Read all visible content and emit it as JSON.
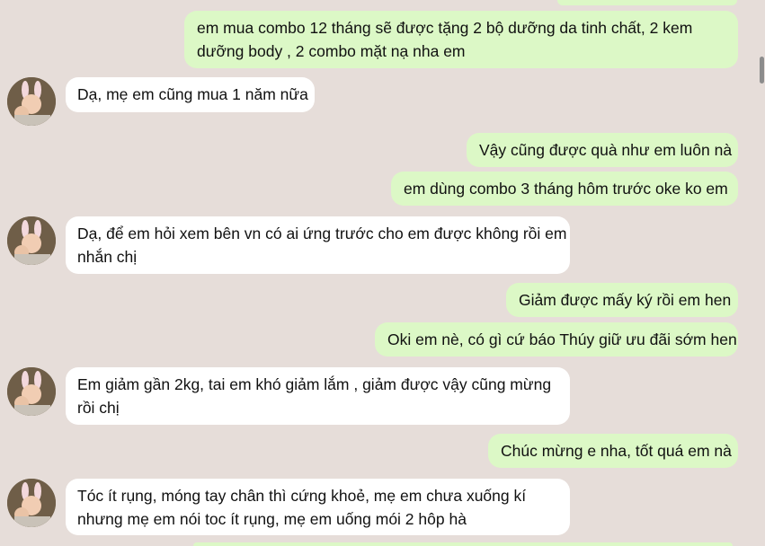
{
  "messages": [
    {
      "dir": "out",
      "text_lines": [
        "em mua combo 12 tháng sẽ được tặng 2 bộ dưỡng da tinh chất, 2 kem",
        "dưỡng body , 2 combo mặt nạ nha em"
      ]
    },
    {
      "dir": "in",
      "text_lines": [
        "Dạ, mẹ em cũng mua 1 năm nữa"
      ]
    },
    {
      "dir": "out",
      "text_lines": [
        "Vậy cũng được quà như em luôn nà"
      ]
    },
    {
      "dir": "out",
      "text_lines": [
        "em dùng combo 3 tháng hôm trước oke ko em"
      ]
    },
    {
      "dir": "in",
      "text_lines": [
        "Dạ, để em hỏi xem bên vn có ai ứng trước cho em được không rồi em",
        "nhắn chị"
      ]
    },
    {
      "dir": "out",
      "text_lines": [
        "Giảm được mấy ký rồi em hen"
      ]
    },
    {
      "dir": "out",
      "text_lines": [
        "Oki em nè, có gì cứ báo Thúy giữ ưu đãi sớm hen"
      ]
    },
    {
      "dir": "in",
      "text_lines": [
        "Em giảm gần 2kg, tai em khó giảm lắm , giảm được vậy cũng mừng",
        "rồi chị"
      ]
    },
    {
      "dir": "out",
      "text_lines": [
        "Chúc mừng e nha, tốt quá em nà"
      ]
    },
    {
      "dir": "in",
      "text_lines": [
        "Tóc ít rụng, móng tay chân thì cứng khoẻ, mẹ em chưa xuống kí",
        "nhưng mẹ em nói toc ít rụng, mẹ em uống mói 2 hôp hà"
      ]
    }
  ],
  "colors": {
    "background": "#e6ddd9",
    "outgoing": "#dcf8c6",
    "incoming": "#ffffff"
  }
}
